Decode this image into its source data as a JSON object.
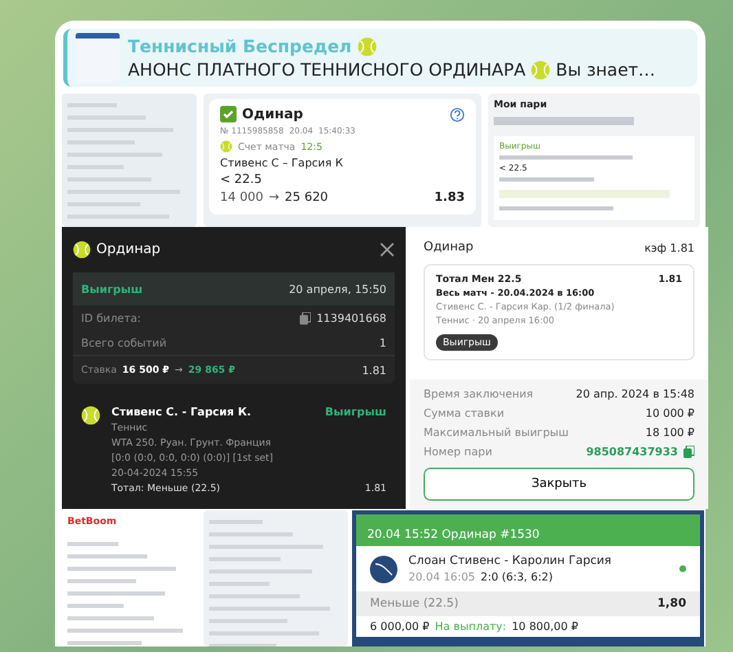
{
  "reply": {
    "title": "Теннисный Беспредел",
    "text": "АНОНС ПЛАТНОГО ТЕННИСНОГО ОРДИНАРА",
    "tail": "Вы знает…"
  },
  "bet_card": {
    "title": "Одинар",
    "number": "№ 1115985858",
    "date": "20.04",
    "time": "15:40:33",
    "score_label": "Счет матча",
    "score": "12:5",
    "match": "Стивенс С – Гарсия К",
    "pick": "< 22.5",
    "stake": "14 000",
    "arrow": "→",
    "payout": "25 620",
    "odds": "1.83"
  },
  "my_bets": {
    "title": "Мои пари",
    "status": "Выигрыш",
    "pick": "< 22.5"
  },
  "dark_ticket": {
    "title": "Ординар",
    "rows": [
      {
        "kind": "status",
        "label": "Выигрыш",
        "value": "20 апреля, 15:50"
      },
      {
        "kind": "copy",
        "label": "ID билета:",
        "value": "1139401668"
      },
      {
        "kind": "plain",
        "label": "Всего событий",
        "value": "1"
      },
      {
        "kind": "stake",
        "label": "Ставка",
        "stake": "16 500 ₽",
        "arrow": "→",
        "payout": "29 865 ₽",
        "value": "1.81"
      }
    ],
    "event": {
      "match": "Стивенс С. - Гарсия К.",
      "status": "Выигрыш",
      "lines": [
        "Теннис",
        "WTA 250. Руан. Грунт. Франция",
        "[0:0 (0:0, 0:0, 0:0) (0:0)] [1st set]",
        "20-04-2024 15:55"
      ],
      "market": "Тотал: Меньше (22.5)",
      "odds": "1.81"
    }
  },
  "light_ticket": {
    "title": "Одинар",
    "odds": "кэф 1.81",
    "card": {
      "market": "Тотал  Мен 22.5",
      "odds": "1.81",
      "period": "Весь матч - 20.04.2024 в 16:00",
      "match": "Стивенс С. - Гарсия Кар. (1/2 финала)",
      "sport": "Теннис · 20 апреля 16:00",
      "status": "Выигрыш"
    },
    "details": [
      {
        "kind": "plain",
        "label": "Время заключения",
        "value": "20 апр. 2024 в 15:48"
      },
      {
        "kind": "plain",
        "label": "Сумма ставки",
        "value": "10 000 ₽"
      },
      {
        "kind": "plain",
        "label": "Максимальный выигрыш",
        "value": "18 100 ₽"
      },
      {
        "kind": "copy",
        "label": "Номер пари",
        "value": "985087437933"
      }
    ],
    "button": "Закрыть"
  },
  "thumb": {
    "logo": "BetBoom"
  },
  "coupon": {
    "header": "20.04 15:52 Ординар #1530",
    "match": "Слоан Стивенс - Каролин Гарсия",
    "time": "20.04 16:05",
    "score": "2:0 (6:3, 6:2)",
    "live": true,
    "pick": "Меньше (22.5)",
    "odds": "1,80",
    "stake": "6 000,00 ₽",
    "payout_label": "На выплату:",
    "payout": "10 800,00 ₽"
  }
}
